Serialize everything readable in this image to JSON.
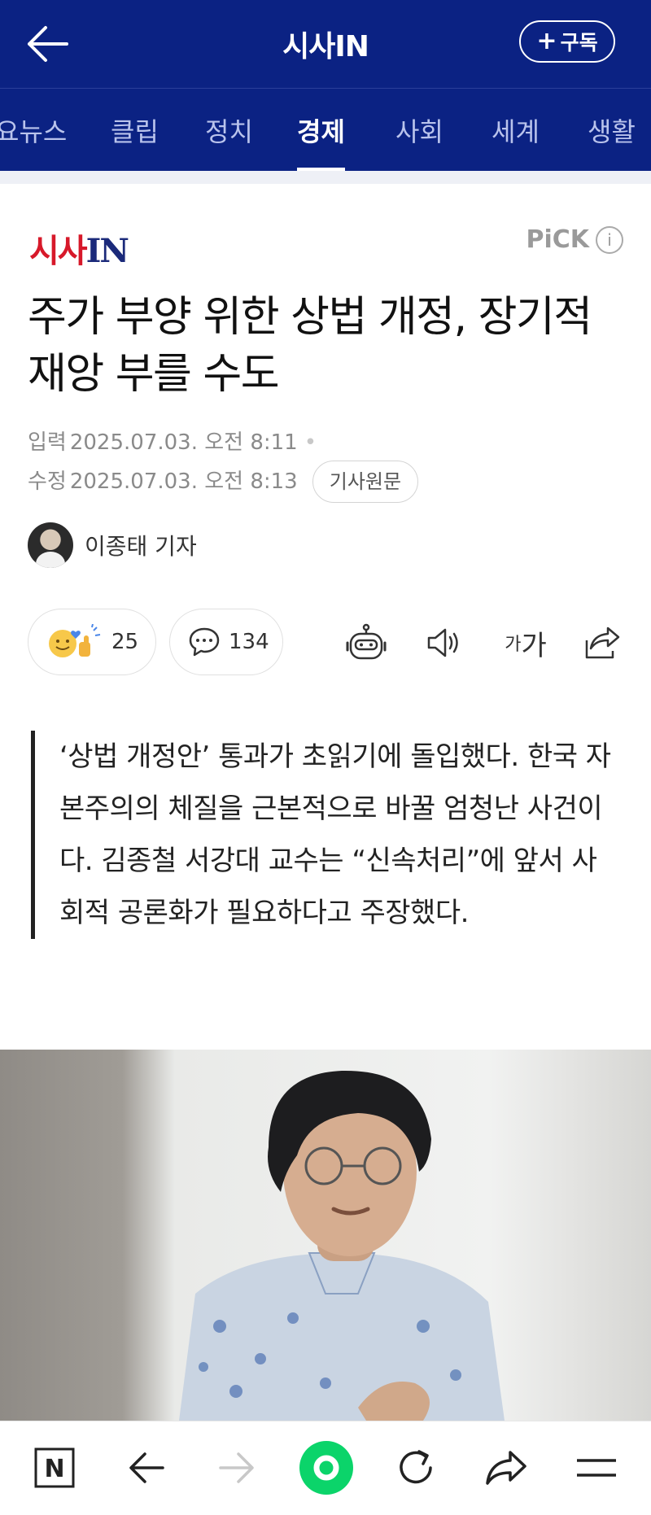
{
  "header": {
    "title": "시사IN",
    "subscribe_label": "구독",
    "subscribe_prefix": "+"
  },
  "tabs": [
    {
      "label": "주요뉴스",
      "visible_text": "요뉴스",
      "active": false
    },
    {
      "label": "클립",
      "active": false
    },
    {
      "label": "정치",
      "active": false
    },
    {
      "label": "경제",
      "active": true
    },
    {
      "label": "사회",
      "active": false
    },
    {
      "label": "세계",
      "active": false
    },
    {
      "label": "생활",
      "active": false
    }
  ],
  "article": {
    "press_logo_a": "시사",
    "press_logo_b": "IN",
    "pick_label": "PiCK",
    "pick_info": "i",
    "headline": "주가 부양 위한 상법 개정, 장기적 재앙 부를 수도",
    "input_date_label": "입력",
    "input_date": "2025.07.03. 오전 8:11",
    "modified_date_label": "수정",
    "modified_date": "2025.07.03. 오전 8:13",
    "original_link": "기사원문",
    "author": "이종태 기자",
    "reaction_count": "25",
    "comment_count": "134",
    "font_size_small": "가",
    "font_size_large": "가",
    "summary": "‘상법 개정안’ 통과가 초읽기에 돌입했다. 한국 자본주의의 체질을 근본적으로 바꿀 엄청난 사건이다. 김종철 서강대 교수는 “신속처리”에 앞서 사회적 공론화가 필요하다고 주장했다."
  },
  "bottom_nav": {
    "home_label": "N"
  },
  "colors": {
    "header_bg": "#0b2283",
    "logo_red": "#d7192a",
    "logo_navy": "#1b2a7a",
    "green_button": "#0bd46a"
  }
}
